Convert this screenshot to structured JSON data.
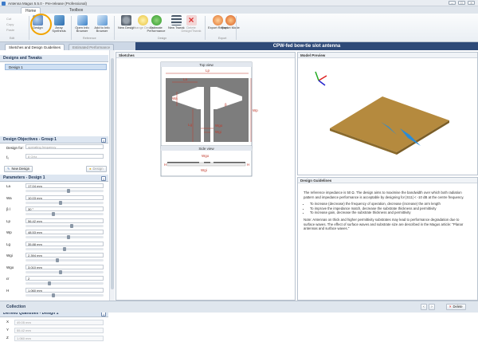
{
  "window": {
    "title": "Antenna Magus 5.5.0 - Pre-release (Professional)"
  },
  "ribbon": {
    "tabs": [
      "Home",
      "Toolbox"
    ],
    "clipboard": [
      "Cut",
      "Copy",
      "Paste",
      "Edit"
    ],
    "buttons": {
      "design": "Design",
      "array_synthesis": "Array Synthesis",
      "open_info": "Open Info Browser",
      "add_info": "Add to Info Browser",
      "new_design": "New Design",
      "change_design": "Change Design",
      "estimate": "Estimate Performance",
      "new_tweak": "New Tweak",
      "delete": "Delete Design/Tweak",
      "export_report": "Export Report",
      "export_mode": "Export Mode"
    },
    "groups": {
      "reference": "Reference",
      "design": "Design",
      "export": "Export"
    }
  },
  "tabs": {
    "sketches": "Sketches and Design Guidelines",
    "estimated": "Estimated Performance"
  },
  "doc_title": "CPW-fed bow-tie slot antenna",
  "left": {
    "designs_header": "Designs and Tweaks",
    "design_item": "Design 1",
    "objectives_header": "Design Objectives - Group 1",
    "design_for_label": "Design for:",
    "design_for_value": "operating frequency",
    "f0_label": "f₀",
    "f0_value": "8 GHz",
    "new_design_btn": "New Design",
    "design_btn": "Design",
    "params_header": "Parameters - Design 1",
    "params": [
      {
        "name": "La",
        "value": "17.04 mm",
        "level": 0.55
      },
      {
        "name": "Wa",
        "value": "10.03 mm",
        "level": 0.45
      },
      {
        "name": "β l",
        "value": "30 °",
        "level": 0.35
      },
      {
        "name": "Lp",
        "value": "56.42 mm",
        "level": 0.6
      },
      {
        "name": "Wp",
        "value": "48.53 mm",
        "level": 0.55
      },
      {
        "name": "Lg",
        "value": "35.88 mm",
        "level": 0.5
      },
      {
        "name": "Wgi",
        "value": "2.394 mm",
        "level": 0.4
      },
      {
        "name": "Wgo",
        "value": "3.010 mm",
        "level": 0.45
      },
      {
        "name": "εr",
        "value": "2",
        "level": 0.3
      },
      {
        "name": "H",
        "value": "1.060 mm",
        "level": 0.35
      }
    ],
    "new_tweak_btn": "New Tweak",
    "estimate_btn": "Estimate Performance",
    "derived_header": "Derived Quantities - Design 1",
    "derived": [
      {
        "name": "X",
        "value": "49.05 mm"
      },
      {
        "name": "Y",
        "value": "55.42 mm"
      },
      {
        "name": "Z",
        "value": "1.060 mm"
      }
    ]
  },
  "sketches": {
    "header": "Sketches",
    "top_view": "Top view",
    "side_view": "Side view",
    "labels": {
      "Lp": "Lp",
      "La": "La",
      "Wa": "Wa",
      "Wp": "Wp",
      "Lg": "Lg",
      "Wgo": "Wgo",
      "Wgi": "Wgi",
      "H": "H",
      "beta": "β"
    }
  },
  "model_preview": {
    "header": "Model Preview"
  },
  "guidelines": {
    "header": "Design Guidelines",
    "intro": "The reference impedance is 50 Ω. The design aims to maximise the bandwidth over which both radiation pattern and impedance performance is acceptable by designing for |S11| < -10 dB at the centre frequency.",
    "bullets": [
      "To increase (decrease) the frequency of operation, decrease (increase) the arm length",
      "To improve the impedance match, decrease the substrate thickness and permittivity",
      "To increase gain, decrease the substrate thickness and permittivity"
    ],
    "note": "Note: Antennas on thick and higher permittivity substrates may lead to performance degradation due to surface waves. The effect of surface waves and substrate size are described in the Magus article: \"Planar antennas and surface waves.\""
  },
  "status": {
    "collection": "Collection",
    "delete": "Delete"
  },
  "colors": {
    "accent": "#2e4a78",
    "highlight": "#f2a400",
    "substrate": "#b58a3e",
    "metal": "#2a8bd6"
  }
}
